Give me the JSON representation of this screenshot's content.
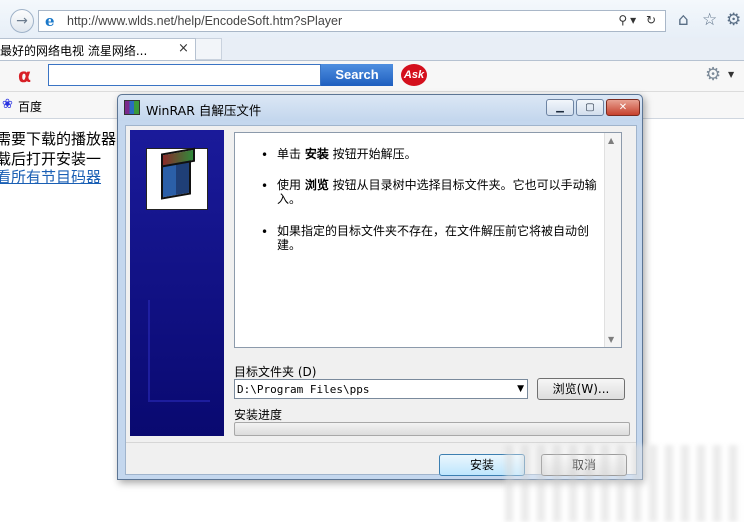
{
  "browser": {
    "url": "http://www.wlds.net/help/EncodeSoft.htm?sPlayer",
    "tab_title": "最好的网络电视 流星网络...",
    "tab_close": "×",
    "search_button": "Search",
    "ask_logo": "Ask",
    "favorites_item": "百度"
  },
  "page": {
    "line1": "需要下载的播放器",
    "line2": "载后打开安装一",
    "line3": "看所有节目码器"
  },
  "dialog": {
    "title": "WinRAR 自解压文件",
    "bullets": [
      {
        "pre": "单击 ",
        "bold": "安装",
        "post": " 按钮开始解压。"
      },
      {
        "pre": "使用 ",
        "bold": "浏览",
        "post": " 按钮从目录树中选择目标文件夹。它也可以手动输入。"
      },
      {
        "pre": "",
        "bold": "",
        "post": "如果指定的目标文件夹不存在，在文件解压前它将被自动创建。"
      }
    ],
    "dest_label": "目标文件夹 (D)",
    "dest_value": "D:\\Program Files\\pps",
    "browse_label": "浏览(W)...",
    "progress_label": "安装进度",
    "progress_fraction": 0,
    "install_label": "安装",
    "cancel_label": "取消"
  }
}
